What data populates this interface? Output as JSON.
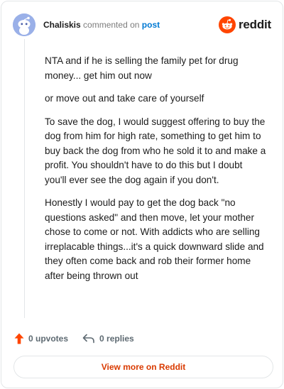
{
  "comment": {
    "username": "Chaliskis",
    "action_text": "commented on",
    "post_link": "post",
    "paragraphs": [
      "NTA and if he is selling the family pet for drug money... get him out now",
      "or move out and take care of yourself",
      "To save the dog, I would suggest offering to buy the dog from him for high rate, something to get him to buy back the dog from who he sold it to and make a profit. You shouldn't have to do this but I doubt you'll ever see the dog again if you don't.",
      "Honestly I would pay to get the dog back \"no questions asked\" and then move, let your mother chose to come or not. With addicts who are selling irreplacable things...it's a quick downward slide and they often come back and rob their former home after being thrown out"
    ]
  },
  "brand": {
    "wordmark": "reddit",
    "icon": "reddit-logo-icon",
    "color": "#ff4500"
  },
  "actions": {
    "upvotes": "0 upvotes",
    "replies": "0 replies",
    "upvote_icon": "upvote-arrow-icon",
    "reply_icon": "reply-arrow-icon",
    "upvote_color": "#ff4500"
  },
  "footer": {
    "view_more_label": "View more on Reddit",
    "view_more_color": "#d93a00"
  }
}
